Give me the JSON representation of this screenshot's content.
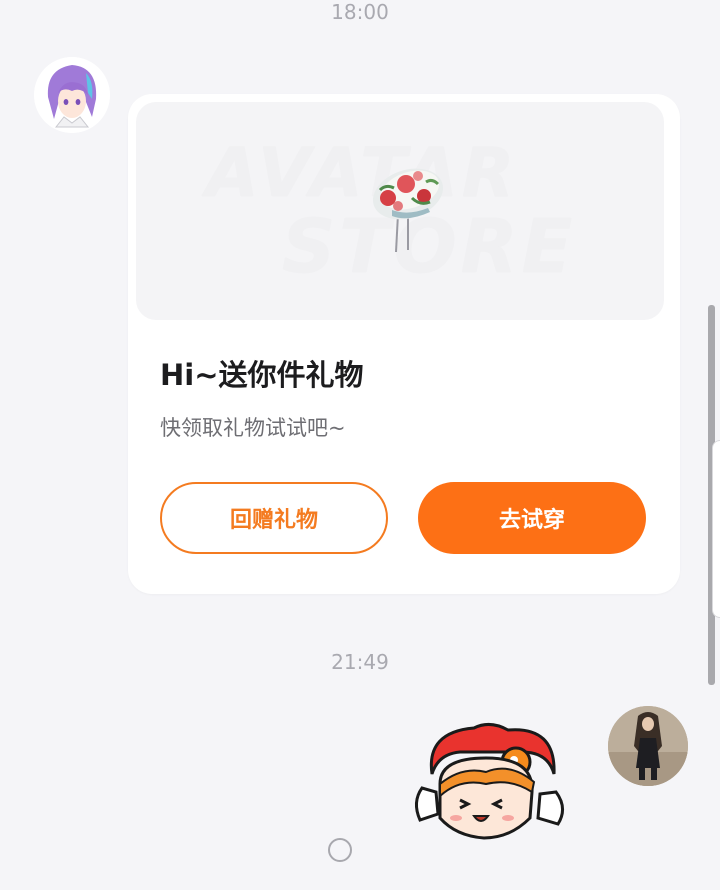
{
  "chat": {
    "timestamps": [
      "18:00",
      "21:49"
    ]
  },
  "gift_card": {
    "banner_watermark_line1": "AVATAR",
    "banner_watermark_line2": "STORE",
    "title": "Hi~送你件礼物",
    "subtitle": "快领取礼物试试吧~",
    "return_gift_label": "回赠礼物",
    "try_on_label": "去试穿"
  },
  "colors": {
    "accent": "#FD7015",
    "outline_accent": "#F47B20",
    "background": "#F5F5F8",
    "card": "#FFFFFF"
  },
  "icons": {
    "sender_avatar": "anime-boy-purple-hair-avatar",
    "receiver_avatar": "user-photo-avatar",
    "gift_item": "floral-hat-icon",
    "sticker": "cartoon-girl-sticker",
    "home_indicator": "circle-home-icon"
  }
}
